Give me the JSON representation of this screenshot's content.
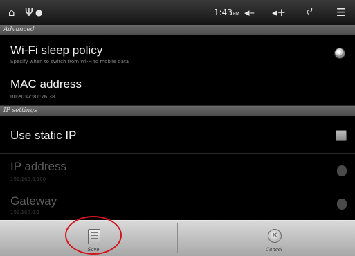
{
  "status_bar": {
    "time": "1:43",
    "ampm": "PM",
    "icons": [
      "home-icon",
      "usb-icon",
      "android-icon",
      "volume-down-icon",
      "volume-up-icon",
      "back-icon",
      "menu-icon"
    ]
  },
  "sections": {
    "advanced": "Advanced",
    "ip_settings": "IP settings"
  },
  "rows": {
    "wifi_sleep": {
      "title": "Wi-Fi sleep policy",
      "subtitle": "Specify when to switch from Wi-Fi to mobile data"
    },
    "mac": {
      "title": "MAC address",
      "value": "00:e0:4c:81:76:38"
    },
    "static_ip": {
      "title": "Use static IP"
    },
    "ip_address": {
      "title": "IP address",
      "value": "192.168.0.100"
    },
    "gateway": {
      "title": "Gateway",
      "value": "192.168.0.1"
    }
  },
  "bottom_bar": {
    "save_label": "Save",
    "cancel_label": "Cancel"
  }
}
